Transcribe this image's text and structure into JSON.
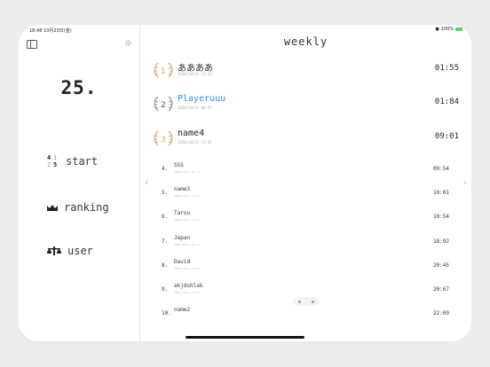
{
  "status": {
    "time": "18:48",
    "date": "10月23日(金)",
    "battery": "100%"
  },
  "sidebar": {
    "big_number": "25.",
    "start_icon_digits": [
      "4",
      "1",
      "2",
      "5"
    ],
    "items": [
      {
        "label": "start",
        "icon": "grid-numbers-icon"
      },
      {
        "label": "ranking",
        "icon": "crown-icon"
      },
      {
        "label": "user",
        "icon": "scales-icon"
      }
    ]
  },
  "main": {
    "title": "weekly",
    "top_ranks": [
      {
        "rank": "1",
        "name": "ああああ",
        "date": "2020/10/22 22:33",
        "time": "01:55",
        "laurel_color": "#c9a96e",
        "name_color": "#222222"
      },
      {
        "rank": "2",
        "name": "Playeruuu",
        "date": "2020/10/21 00:41",
        "time": "01:84",
        "laurel_color": "#8c8c8c",
        "name_color": "#2f8fd9"
      },
      {
        "rank": "3",
        "name": "name4",
        "date": "2020/10/21 13:45",
        "time": "09:01",
        "laurel_color": "#c9a96e",
        "name_color": "#222222"
      }
    ],
    "rows": [
      {
        "rank": "4.",
        "name": "SSS",
        "date": "2020/10/21 00:13",
        "time": "09:54"
      },
      {
        "rank": "5.",
        "name": "name3",
        "date": "2020/10/21 11:00",
        "time": "10:01"
      },
      {
        "rank": "6.",
        "name": "Tarou",
        "date": "2020/10/21 12:00",
        "time": "10:54"
      },
      {
        "rank": "7.",
        "name": "Japan",
        "date": "2020/10/21 00:21",
        "time": "18:92"
      },
      {
        "rank": "8.",
        "name": "David",
        "date": "2020/10/21 11:00",
        "time": "20:45"
      },
      {
        "rank": "9.",
        "name": "akjdshlak",
        "date": "2020/10/21 11:00",
        "time": "20:67"
      },
      {
        "rank": "10.",
        "name": "name2",
        "date": "",
        "time": "22:09"
      }
    ]
  }
}
